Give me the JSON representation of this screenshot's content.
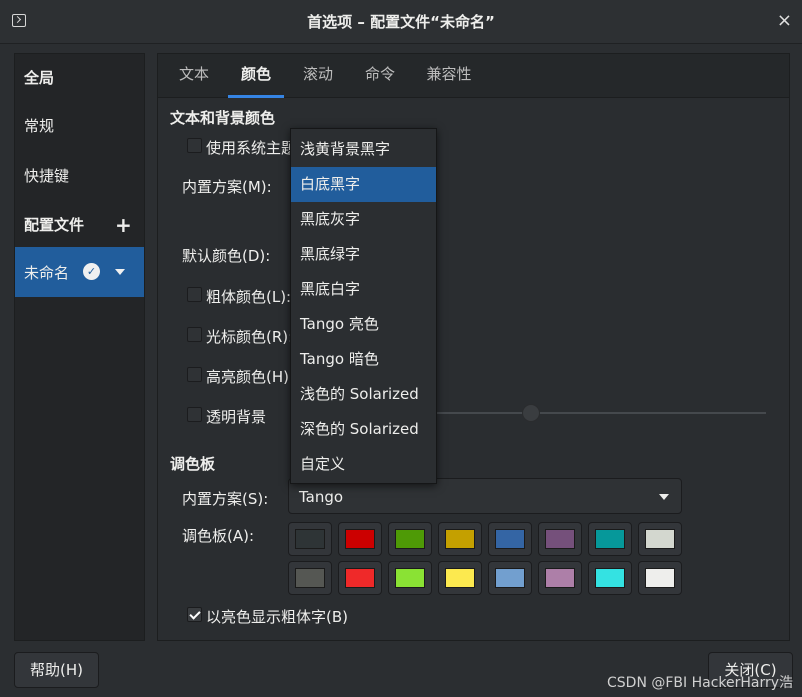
{
  "window": {
    "title": "首选项 – 配置文件“未命名”",
    "close": "×"
  },
  "sidebar": {
    "global": "全局",
    "general": "常规",
    "shortcuts": "快捷键",
    "profiles": "配置文件",
    "add": "+",
    "profile_name": "未命名"
  },
  "tabs": [
    "文本",
    "颜色",
    "滚动",
    "命令",
    "兼容性"
  ],
  "active_tab": "颜色",
  "text_bg": {
    "title": "文本和背景颜色",
    "use_system_theme": "使用系统主题",
    "builtin_scheme": "内置方案(M):",
    "default_color": "默认颜色(D):",
    "bold_color": "粗体颜色(L):",
    "cursor_color": "光标颜色(R):",
    "highlight_color": "高亮颜色(H):",
    "transparent_bg": "透明背景"
  },
  "scheme_dropdown": {
    "items": [
      "浅黄背景黑字",
      "白底黑字",
      "黑底灰字",
      "黑底绿字",
      "黑底白字",
      "Tango 亮色",
      "Tango 暗色",
      "浅色的 Solarized",
      "深色的 Solarized",
      "自定义"
    ],
    "selected": "白底黑字"
  },
  "palette": {
    "title": "调色板",
    "builtin_label": "内置方案(S):",
    "builtin_value": "Tango",
    "palette_label": "调色板(A):",
    "colors_row1": [
      "#2e3436",
      "#cc0000",
      "#4e9a06",
      "#c4a000",
      "#3465a4",
      "#75507b",
      "#06989a",
      "#d3d7cf"
    ],
    "colors_row2": [
      "#555753",
      "#ef2929",
      "#8ae234",
      "#fce94f",
      "#729fcf",
      "#ad7fa8",
      "#34e2e2",
      "#eeeeec"
    ],
    "bold_bright": "以亮色显示粗体字(B)",
    "bold_bright_checked": true
  },
  "buttons": {
    "help": "帮助(H)",
    "close": "关闭(C)"
  },
  "watermark": "CSDN @FBI HackerHarry浩",
  "accent": "#215d9c"
}
